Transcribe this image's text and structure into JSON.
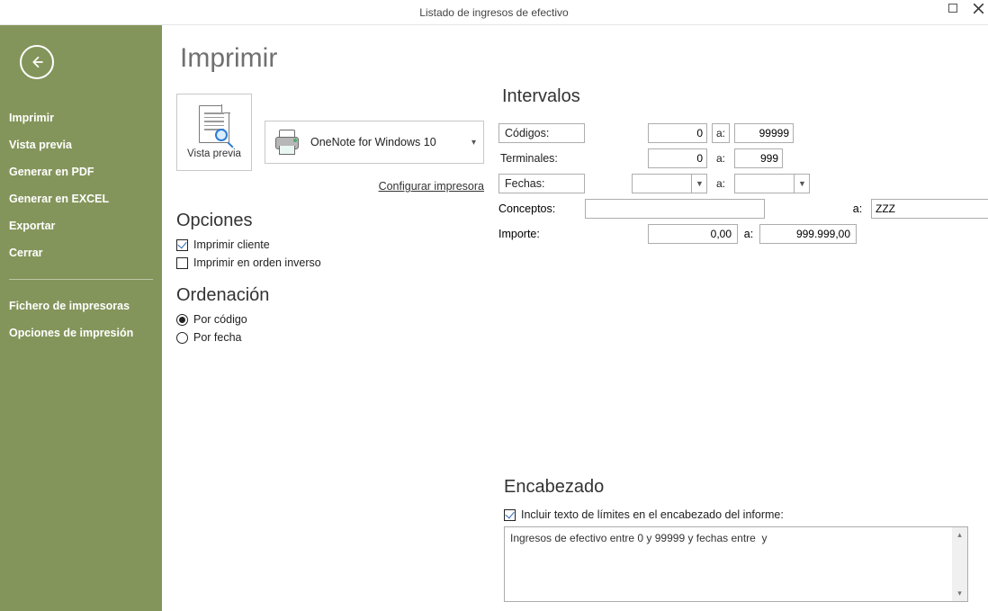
{
  "window": {
    "title": "Listado de ingresos de efectivo"
  },
  "sidebar": {
    "items": [
      "Imprimir",
      "Vista previa",
      "Generar en PDF",
      "Generar en EXCEL",
      "Exportar",
      "Cerrar"
    ],
    "items2": [
      "Fichero de impresoras",
      "Opciones de impresión"
    ]
  },
  "page": {
    "title": "Imprimir"
  },
  "preview": {
    "caption": "Vista previa"
  },
  "printer": {
    "name": "OneNote for Windows 10",
    "config_link": "Configurar impresora"
  },
  "opciones": {
    "title": "Opciones",
    "chk1": "Imprimir cliente",
    "chk2": "Imprimir en orden inverso"
  },
  "ordenacion": {
    "title": "Ordenación",
    "r1": "Por código",
    "r2": "Por fecha"
  },
  "intervalos": {
    "title": "Intervalos",
    "codigos_label": "Códigos:",
    "codigos_from": "0",
    "codigos_to": "99999",
    "a_sep": "a:",
    "terminales_label": "Terminales:",
    "terminales_from": "0",
    "terminales_to": "999",
    "fechas_label": "Fechas:",
    "fechas_from": "",
    "fechas_to": "",
    "conceptos_label": "Conceptos:",
    "conceptos_from": "",
    "conceptos_to": "ZZZ",
    "importe_label": "Importe:",
    "importe_from": "0,00",
    "importe_to": "999.999,00"
  },
  "encabezado": {
    "title": "Encabezado",
    "chk": "Incluir texto de límites en el encabezado del informe:",
    "text": "Ingresos de efectivo entre 0 y 99999 y fechas entre  y "
  }
}
